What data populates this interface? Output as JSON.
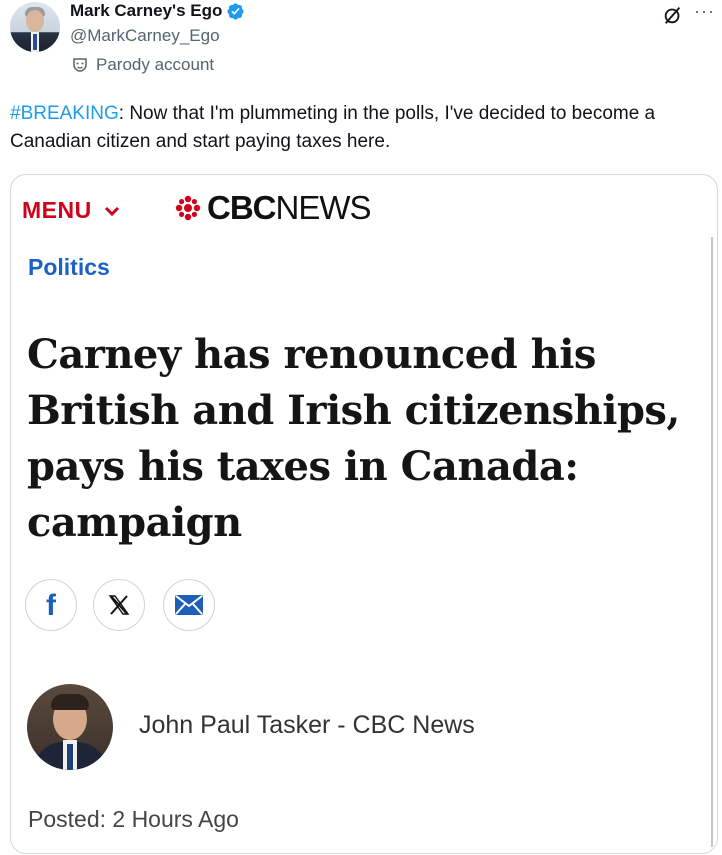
{
  "post": {
    "display_name": "Mark Carney's Ego",
    "handle": "@MarkCarney_Ego",
    "parody_label": "Parody account",
    "more_label": "···",
    "hashtag": "#BREAKING",
    "text": ": Now that I'm plummeting in the polls, I've decided to become a Canadian citizen and start paying taxes here.",
    "icons": [
      "verified-badge-icon",
      "parody-mask-icon",
      "grok-icon",
      "more-icon"
    ],
    "colors": {
      "hashtag": "#1d9bf0",
      "verified": "#1d9bf0",
      "secondary_text": "#536471"
    }
  },
  "card": {
    "menu_label": "MENU",
    "brand_bold": "CBC",
    "brand_light": "NEWS",
    "section": "Politics",
    "headline": "Carney has renounced his British and Irish citizenships, pays his taxes in Canada: campaign",
    "share_icons": [
      "facebook-icon",
      "x-icon",
      "mail-icon"
    ],
    "facebook_glyph": "f",
    "author": "John Paul Tasker - CBC News",
    "posted": "Posted: 2 Hours Ago",
    "colors": {
      "menu": "#d0021b",
      "section": "#1b62c7",
      "headline": "#151515"
    }
  }
}
